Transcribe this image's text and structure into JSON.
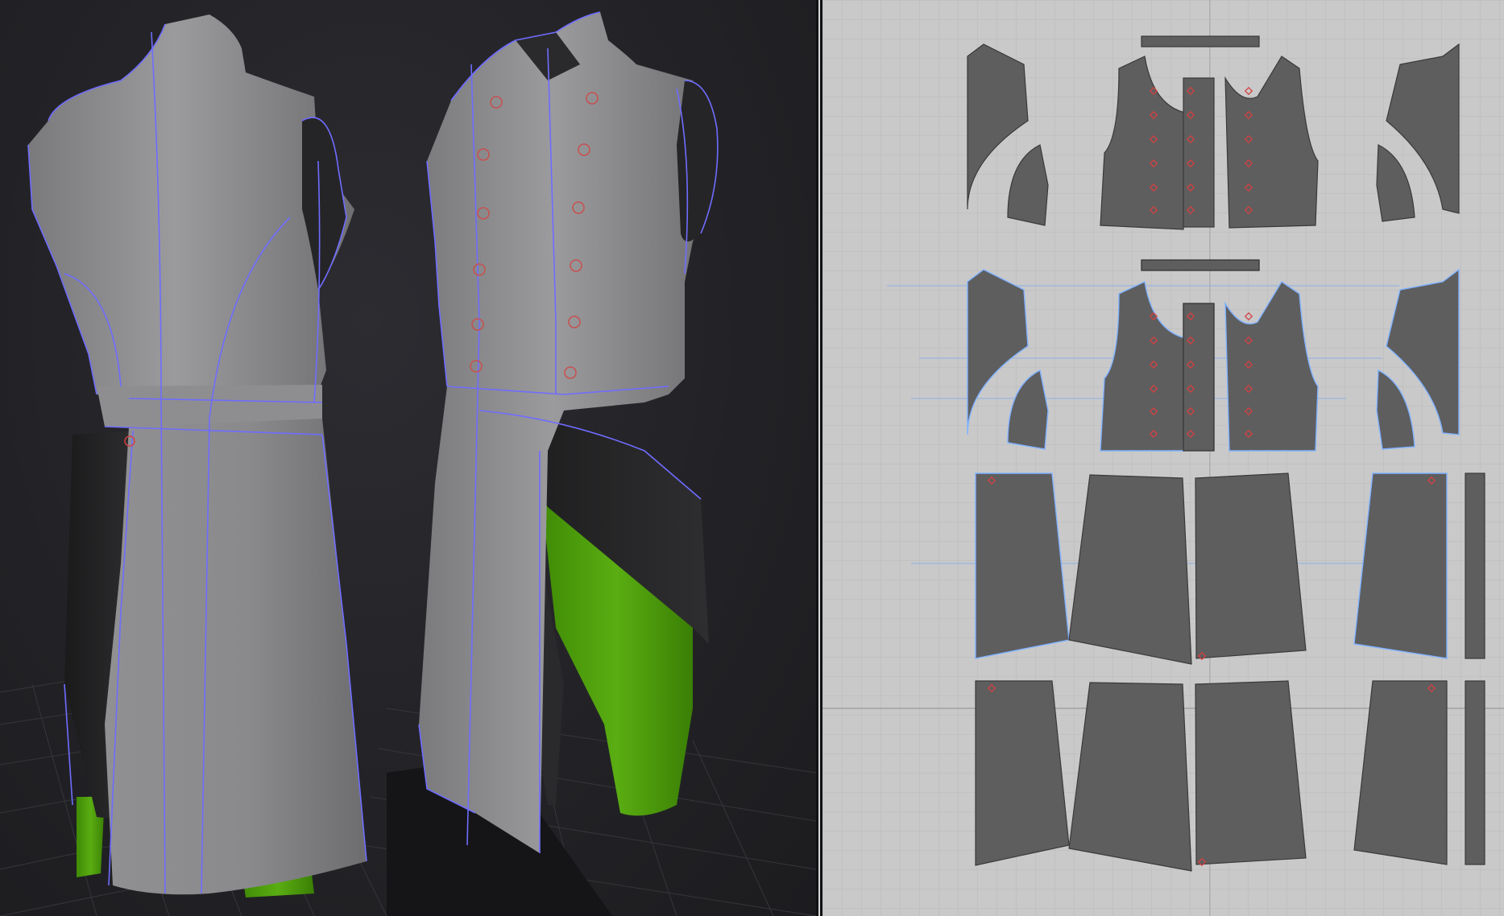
{
  "app": {
    "window_title": "",
    "panels": {
      "viewport_3d": {
        "label": ""
      },
      "viewport_2d": {
        "label": ""
      }
    }
  },
  "colors": {
    "viewport_3d_bg": "#232327",
    "garment_fabric": "#8d8d8f",
    "garment_dark_fabric": "#262628",
    "pants_fabric": "#4a9a0c",
    "seam_line": "#6f6cff",
    "pattern_bg": "#c9c9ca",
    "pattern_grid": "#b9b9bb",
    "pattern_piece": "#5e5e5f",
    "pattern_outline_selected": "#7fb2ff",
    "button_marker": "#d64040",
    "sewing_line": "#8fb0e0"
  },
  "icons": {
    "avatar_back_view": "garment-back-view",
    "avatar_front_view": "garment-front-view"
  }
}
